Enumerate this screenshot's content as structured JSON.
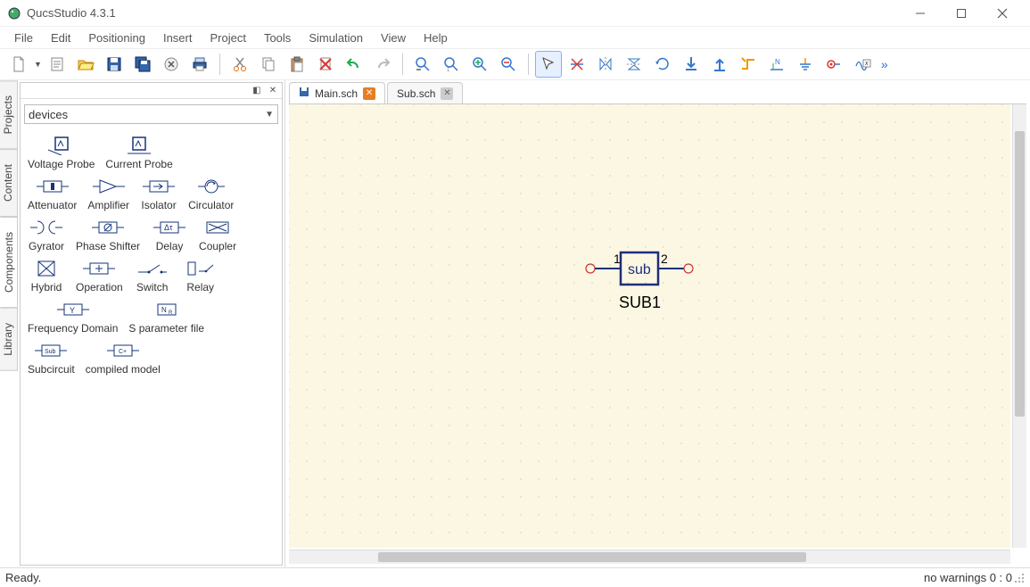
{
  "title": "QucsStudio 4.3.1",
  "menus": [
    "File",
    "Edit",
    "Positioning",
    "Insert",
    "Project",
    "Tools",
    "Simulation",
    "View",
    "Help"
  ],
  "sidepanel": {
    "vtabs": [
      "Projects",
      "Content",
      "Components",
      "Library"
    ],
    "active_vtab": 2,
    "combo": "devices",
    "components": [
      [
        "Voltage Probe",
        "Current Probe"
      ],
      [
        "Attenuator",
        "Amplifier",
        "Isolator",
        "Circulator"
      ],
      [
        "Gyrator",
        "Phase Shifter",
        "Delay",
        "Coupler"
      ],
      [
        "Hybrid",
        "Operation",
        "Switch",
        "Relay"
      ],
      [
        "Frequency Domain",
        "S parameter file"
      ],
      [
        "Subcircuit",
        "compiled model"
      ]
    ]
  },
  "tabs": [
    {
      "label": "Main.sch",
      "active": true,
      "closable": true,
      "saved": true
    },
    {
      "label": "Sub.sch",
      "active": false,
      "closable": true,
      "saved": false
    }
  ],
  "canvas": {
    "subcircuit": {
      "port1": "1",
      "port2": "2",
      "box": "sub",
      "name": "SUB1"
    }
  },
  "status": {
    "left": "Ready.",
    "right": "no warnings  0 : 0"
  }
}
